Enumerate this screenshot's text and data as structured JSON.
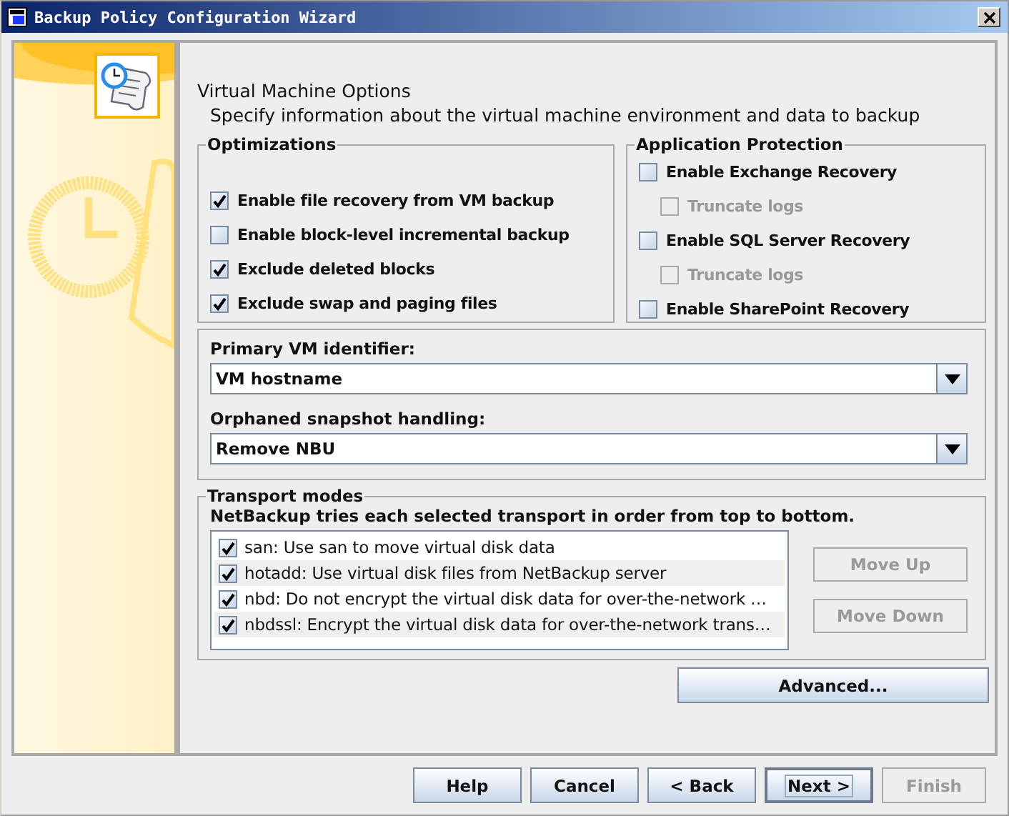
{
  "window": {
    "title": "Backup Policy Configuration Wizard"
  },
  "page": {
    "title": "Virtual Machine Options",
    "subtitle": "Specify information about the virtual machine environment and data to backup"
  },
  "optimizations": {
    "title": "Optimizations",
    "options": [
      {
        "label": "Enable file recovery from VM backup",
        "checked": true
      },
      {
        "label": "Enable block-level incremental backup",
        "checked": false
      },
      {
        "label": "Exclude deleted blocks",
        "checked": true
      },
      {
        "label": "Exclude swap and paging files",
        "checked": true
      }
    ]
  },
  "application_protection": {
    "title": "Application Protection",
    "options": [
      {
        "label": "Enable Exchange Recovery",
        "checked": false,
        "children": [
          {
            "label": "Truncate logs",
            "checked": false,
            "disabled": true
          }
        ]
      },
      {
        "label": "Enable SQL Server Recovery",
        "checked": false,
        "children": [
          {
            "label": "Truncate logs",
            "checked": false,
            "disabled": true
          }
        ]
      },
      {
        "label": "Enable SharePoint Recovery",
        "checked": false
      }
    ]
  },
  "vm_settings": [
    {
      "label": "Primary VM identifier:",
      "value": "VM hostname"
    },
    {
      "label": "Orphaned snapshot handling:",
      "value": "Remove NBU"
    }
  ],
  "transport_modes": {
    "title": "Transport modes",
    "description": "NetBackup tries each selected transport in order from top to bottom.",
    "items": [
      {
        "label": "san: Use san to move virtual disk data",
        "checked": true
      },
      {
        "label": "hotadd: Use virtual disk files from NetBackup server",
        "checked": true
      },
      {
        "label": "nbd: Do not encrypt the virtual disk data for over-the-network …",
        "checked": true
      },
      {
        "label": "nbdssl: Encrypt the virtual disk data for over-the-network trans…",
        "checked": true
      }
    ],
    "buttons": [
      {
        "label": "Move Up",
        "disabled": true
      },
      {
        "label": "Move Down",
        "disabled": true
      }
    ]
  },
  "advanced_button": {
    "label": "Advanced..."
  },
  "buttons": [
    {
      "label": "Help",
      "disabled": false,
      "default": false
    },
    {
      "label": "Cancel",
      "disabled": false,
      "default": false
    },
    {
      "label": "< Back",
      "disabled": false,
      "default": false
    },
    {
      "label": "Next >",
      "disabled": false,
      "default": true
    },
    {
      "label": "Finish",
      "disabled": true,
      "default": false
    }
  ]
}
